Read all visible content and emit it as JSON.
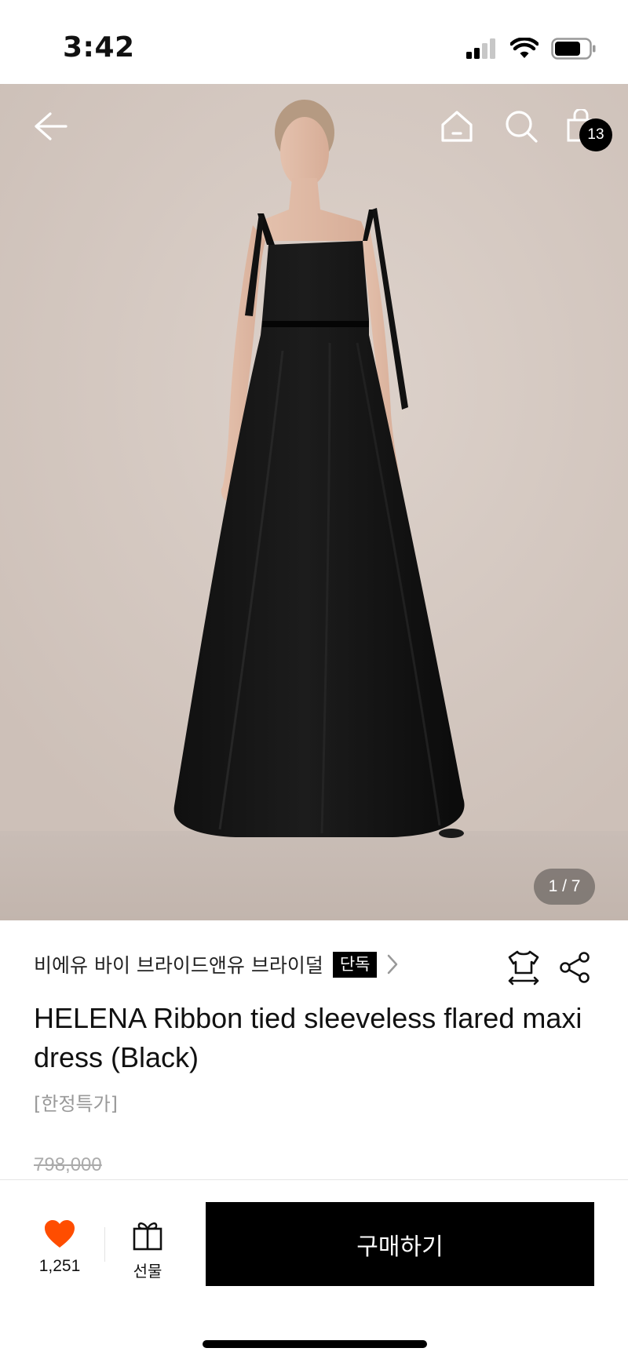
{
  "status_bar": {
    "time": "3:42"
  },
  "hero": {
    "cart_count": "13",
    "page_indicator": "1 / 7",
    "icons": [
      "back-arrow-icon",
      "home-icon",
      "search-icon",
      "shopping-bag-icon"
    ]
  },
  "product": {
    "brand": "비에유 바이 브라이드앤유 브라이덜",
    "brand_tag": "단독",
    "title": "HELENA Ribbon tied sleeveless flared maxi dress (Black)",
    "subtitle": "[한정특가]",
    "original_price": "798,000"
  },
  "bottom_bar": {
    "like_count": "1,251",
    "gift_label": "선물",
    "buy_label": "구매하기"
  },
  "colors": {
    "accent_like": "#ff4d00",
    "buy_button_bg": "#000000",
    "background": "#ffffff"
  }
}
